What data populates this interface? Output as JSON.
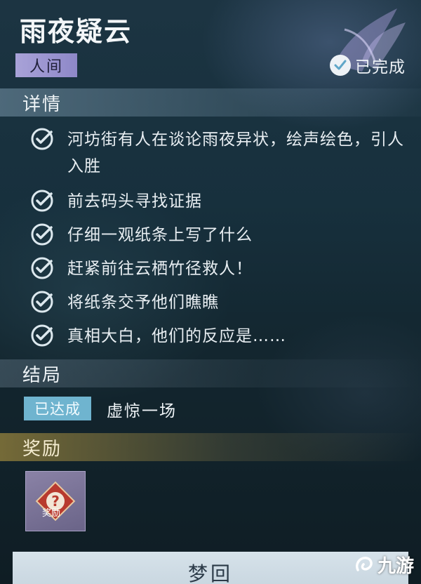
{
  "quest": {
    "title": "雨夜疑云",
    "category": "人间",
    "status": "已完成"
  },
  "details": {
    "heading": "详情",
    "tasks": [
      "河坊街有人在谈论雨夜异状，绘声绘色，引人入胜",
      "前去码头寻找证据",
      "仔细一观纸条上写了什么",
      "赶紧前往云栖竹径救人！",
      "将纸条交予他们瞧瞧",
      "真相大白，他们的反应是……"
    ]
  },
  "ending": {
    "heading": "结局",
    "tag": "已达成",
    "text": "虚惊一场"
  },
  "reward": {
    "heading": "奖励",
    "icon_label": "奖励",
    "icon": "mystery-reward-icon"
  },
  "footer": {
    "button_label": "梦回",
    "watermark": "九游"
  },
  "colors": {
    "category_bg": "#a8a2d8",
    "achieved_bg": "#6fb4cf",
    "reward_band": "#96823c",
    "check": "#dce8ee"
  }
}
